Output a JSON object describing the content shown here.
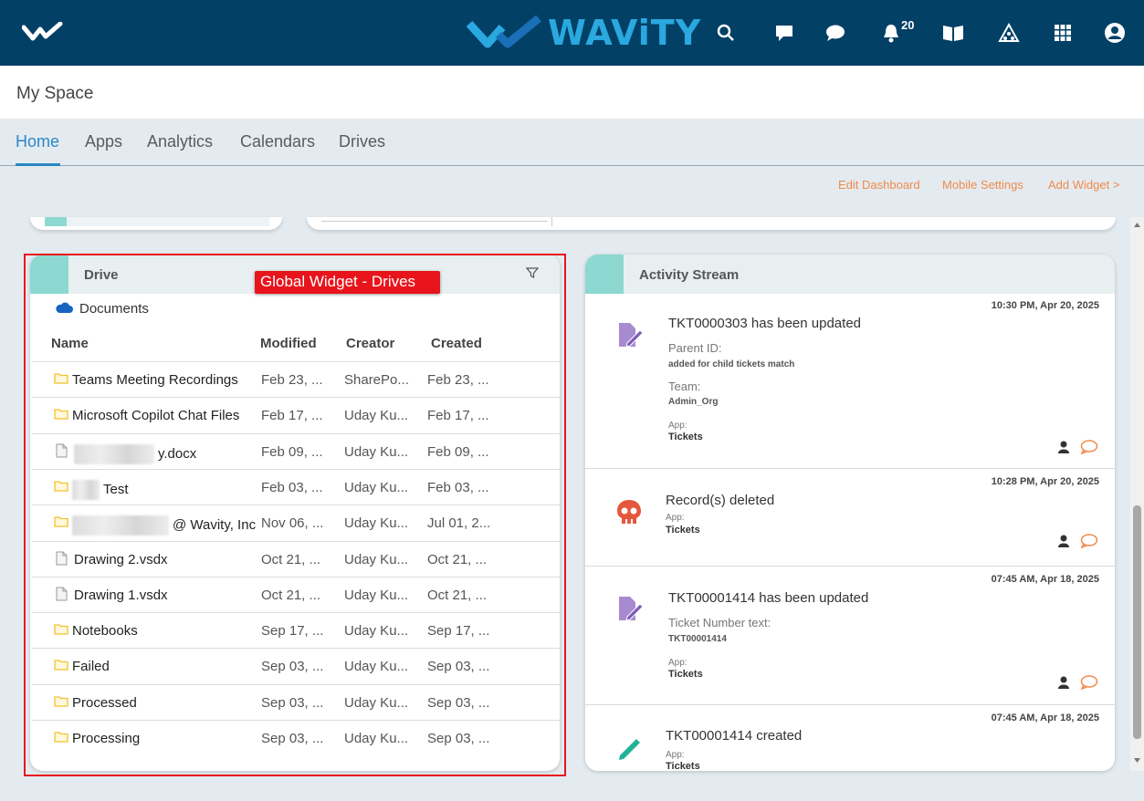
{
  "header": {
    "brand": "WAViTY",
    "notifications_count": "20",
    "icons": [
      "search-icon",
      "chat-square-icon",
      "chat-bubble-icon",
      "bell-icon",
      "book-icon",
      "network-icon",
      "grid-icon",
      "user-icon"
    ]
  },
  "page_title": "My Space",
  "tabs": [
    {
      "label": "Home",
      "active": true
    },
    {
      "label": "Apps"
    },
    {
      "label": "Analytics"
    },
    {
      "label": "Calendars"
    },
    {
      "label": "Drives"
    }
  ],
  "actions": {
    "edit_dashboard": "Edit Dashboard",
    "mobile_settings": "Mobile Settings",
    "add_widget": "Add Widget >"
  },
  "callout": "Global Widget - Drives",
  "drive": {
    "title": "Drive",
    "location": "Documents",
    "columns": {
      "name": "Name",
      "modified": "Modified",
      "creator": "Creator",
      "created": "Created"
    },
    "rows": [
      {
        "type": "folder",
        "name": "Teams Meeting Recordings",
        "modified": "Feb 23, ...",
        "creator": "SharePo...",
        "created": "Feb 23, ..."
      },
      {
        "type": "folder",
        "name": "Microsoft Copilot Chat Files",
        "modified": "Feb 17, ...",
        "creator": "Uday Ku...",
        "created": "Feb 17, ..."
      },
      {
        "type": "file",
        "name": "y.docx",
        "modified": "Feb 09, ...",
        "creator": "Uday Ku...",
        "created": "Feb 09, ..."
      },
      {
        "type": "folder",
        "name": "Test",
        "modified": "Feb 03, ...",
        "creator": "Uday Ku...",
        "created": "Feb 03, ..."
      },
      {
        "type": "folder",
        "name": "@ Wavity, Inc",
        "modified": "Nov 06, ...",
        "creator": "Uday Ku...",
        "created": "Jul 01, 2..."
      },
      {
        "type": "file",
        "name": "Drawing 2.vsdx",
        "modified": "Oct 21, ...",
        "creator": "Uday Ku...",
        "created": "Oct 21, ..."
      },
      {
        "type": "file",
        "name": "Drawing 1.vsdx",
        "modified": "Oct 21, ...",
        "creator": "Uday Ku...",
        "created": "Oct 21, ..."
      },
      {
        "type": "folder",
        "name": "Notebooks",
        "modified": "Sep 17, ...",
        "creator": "Uday Ku...",
        "created": "Sep 17, ..."
      },
      {
        "type": "folder",
        "name": "Failed",
        "modified": "Sep 03, ...",
        "creator": "Uday Ku...",
        "created": "Sep 03, ..."
      },
      {
        "type": "folder",
        "name": "Processed",
        "modified": "Sep 03, ...",
        "creator": "Uday Ku...",
        "created": "Sep 03, ..."
      },
      {
        "type": "folder",
        "name": "Processing",
        "modified": "Sep 03, ...",
        "creator": "Uday Ku...",
        "created": "Sep 03, ..."
      }
    ]
  },
  "activity": {
    "title": "Activity Stream",
    "items": [
      {
        "time": "10:30 PM, Apr 20, 2025",
        "title": "TKT0000303 has been updated",
        "f1_label": "Parent ID:",
        "f1_value": "added for child tickets match",
        "f2_label": "Team:",
        "f2_value": "Admin_Org",
        "app_label": "App:",
        "app_value": "Tickets"
      },
      {
        "time": "10:28 PM, Apr 20, 2025",
        "title": "Record(s) deleted",
        "app_label": "App:",
        "app_value": "Tickets"
      },
      {
        "time": "07:45 AM, Apr 18, 2025",
        "title": "TKT00001414 has been updated",
        "f1_label": "Ticket Number text:",
        "f1_value": "TKT00001414",
        "app_label": "App:",
        "app_value": "Tickets"
      },
      {
        "time": "07:45 AM, Apr 18, 2025",
        "title": "TKT00001414 created",
        "app_label": "App:",
        "app_value": "Tickets"
      }
    ]
  },
  "colors": {
    "header_bg": "#034066",
    "accent": "#2a87c6",
    "action": "#f08a4b",
    "highlight": "#e8141c"
  }
}
